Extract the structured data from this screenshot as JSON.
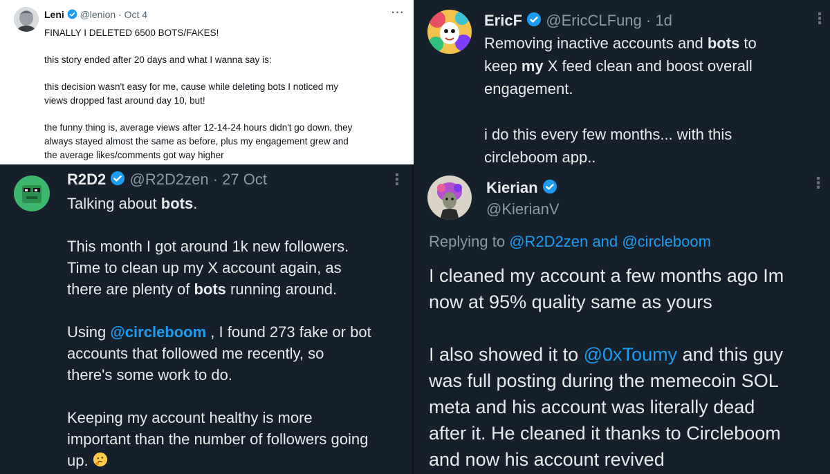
{
  "tweet1": {
    "name": "Leni",
    "handle": "@lenion",
    "sep": "·",
    "date": "Oct 4",
    "more": "···",
    "lines": [
      "FINALLY I DELETED 6500 BOTS/FAKES!",
      "this story ended after 20 days and what I wanna say is:",
      "this decision wasn't easy for me, cause while deleting bots I noticed my",
      "views dropped fast around day 10, but!",
      "the funny thing is, average views after 12-14-24 hours didn't go down, they",
      "always stayed almost the same as before, plus my engagement grew and",
      "the average likes/comments got way higher"
    ]
  },
  "tweet2": {
    "name": "EricF",
    "handle": "@EricCLFung",
    "sep": "·",
    "date": "1d",
    "more": "⋮",
    "l1a": "Removing inactive accounts and ",
    "l1b": "bots",
    "l1c": " to",
    "l2a": "keep ",
    "l2b": "my",
    "l2c": " X feed clean and boost overall",
    "l3": "engagement.",
    "l4": "i do this every few months... with this",
    "l5": "circleboom app.."
  },
  "tweet3": {
    "name": "R2D2",
    "handle": "@R2D2zen",
    "sep": "·",
    "date": "27 Oct",
    "more": "⋮",
    "l1a": "Talking about ",
    "l1b": "bots",
    "l1c": ".",
    "l2": "This month I got around 1k new followers.",
    "l3": "Time to clean up my X account again, as",
    "l4a": "there are plenty of ",
    "l4b": "bots",
    "l4c": " running around.",
    "l5a": "Using ",
    "l5link": "@circleboom",
    "l5c": " , I found 273 fake or bot",
    "l6": "accounts that followed me recently, so",
    "l7": "there's some work to do.",
    "l8": "Keeping my account healthy is more",
    "l9": "important than the number of followers going",
    "l10": "up."
  },
  "tweet4": {
    "name": "Kierian",
    "handle": "@KierianV",
    "more": "⋮",
    "replying": "Replying to",
    "reply_to1": "@R2D2zen",
    "reply_and": "and",
    "reply_to2": "@circleboom",
    "l1": "I cleaned my account a few months ago Im",
    "l2": "now at 95% quality same as yours",
    "l3a": "I also showed it to ",
    "l3link": "@0xToumy",
    "l3c": " and this guy",
    "l4": "was full posting during the memecoin SOL",
    "l5": "meta and his account was literally dead",
    "l6": "after it. He cleaned it thanks to Circleboom",
    "l7": "and now his account revived"
  },
  "colors": {
    "link": "#1d9bf0",
    "verified": "#1d9bf0",
    "dark_bg": "#15202b",
    "muted": "#8b98a5"
  },
  "icons": [
    "verified-badge-icon",
    "more-options-icon",
    "thinking-face-emoji"
  ]
}
